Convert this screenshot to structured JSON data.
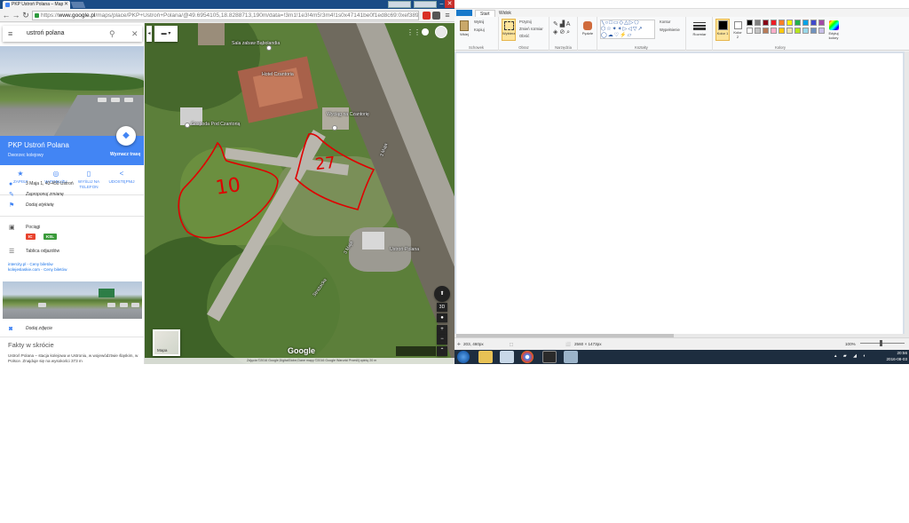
{
  "browser": {
    "tab_title": "PKP Ustroń Polana – Map",
    "url_scheme": "https://",
    "url_host": "www.google.pl",
    "url_path": "/maps/place/PKP+Ustroń+Polana/@49.6954105,18.8288713,190m/data=!3m1!1e3!4m5!3m4!1s0x47141be0f1ed8c69:0xef389"
  },
  "maps": {
    "search_value": "ustroń polana",
    "place_name": "PKP Ustroń Polana",
    "place_type": "Dworzec kolejowy",
    "route_label": "Wyznacz trasę",
    "actions": [
      "ZAPISZ",
      "W POBLIŻU",
      "WYŚLIJ NA TELEFON",
      "UDOSTĘPNIJ"
    ],
    "address": "3 Maja 1, 43-450 Ustroń",
    "suggest_edit": "Zaproponuj zmianę",
    "add_label": "Dodaj etykietę",
    "trains_label": "Pociągi",
    "train_badges": [
      {
        "label": "IC",
        "color": "#e8432e"
      },
      {
        "label": "KSL",
        "color": "#3b9b3b"
      }
    ],
    "departures": "Tablica odjazdów",
    "link1": "intercity.pl - Ceny biletów",
    "link2": "kolejeslaskie.com - Ceny biletów",
    "add_photo": "Dodaj zdjęcie",
    "facts_heading": "Fakty w skrócie",
    "facts_text": "Ustroń Polana – stacja kolejowa w Ustroniu, w województwie śląskim, w Polsce. Znajduje się na wysokości 373 m"
  },
  "map": {
    "labels": {
      "sala": "Sala zabaw Bąbolandia",
      "hotel": "Hotel Czantoria",
      "wyciag": "Wyciąg na Czantorię",
      "gospoda": "Gospoda Pod Czantorią",
      "stacja": "Ustroń-Polana",
      "road1": "3 Maja",
      "road2": "3 Maja",
      "road3": "Strażacka"
    },
    "annotation_10": "10",
    "annotation_27": "27",
    "google_logo": "Google",
    "footer": "Zdjęcia ©2016 Google,DigitalGlobe,Dane mapy ©2016 Google  Warunki  Prześlij opinię  20 m",
    "satellite_label": "Mapa",
    "controls": {
      "tilt": "3D",
      "zoom_in": "+",
      "zoom_out": "−"
    }
  },
  "paint": {
    "tabs": [
      "Start",
      "Widok"
    ],
    "clipboard": {
      "paste": "Wklej",
      "cut": "Wytnij",
      "copy": "Kopiuj",
      "label": "Schowek"
    },
    "image": {
      "select": "Wybierz",
      "crop": "Przytnij",
      "resize": "Zmień rozmiar",
      "rotate": "Obróć",
      "label": "Obraz"
    },
    "tools_label": "Narzędzia",
    "brushes": "Pędzle",
    "shapes": {
      "outline": "Kontur",
      "fill": "Wypełnienie",
      "label": "Kształty"
    },
    "size": "Rozmiar",
    "color1": "Kolor 1",
    "color2": "Kolor 2",
    "edit_colors": "Edytuj kolory",
    "colors_label": "Kolory",
    "palette": [
      "#000000",
      "#7f7f7f",
      "#880015",
      "#ed1c24",
      "#ff7f27",
      "#fff200",
      "#22b14c",
      "#00a2e8",
      "#3f48cc",
      "#a349a4",
      "#ffffff",
      "#c3c3c3",
      "#b97a57",
      "#ffaec9",
      "#ffc90e",
      "#efe4b0",
      "#b5e61d",
      "#99d9ea",
      "#7092be",
      "#c8bfe7"
    ],
    "status_pos": "203, 460px",
    "status_size": "2560 × 1473px",
    "zoom": "100%"
  },
  "taskbar": {
    "time": "20:56",
    "date": "2016-08-03"
  }
}
